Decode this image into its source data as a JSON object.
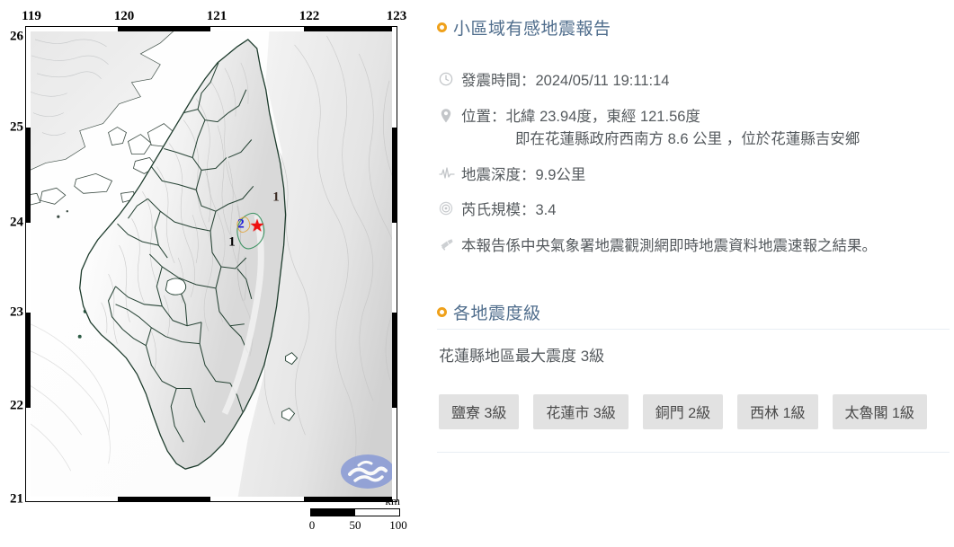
{
  "report": {
    "heading": "小區域有感地震報告",
    "details": [
      {
        "icon": "clock-icon",
        "label": "發震時間：",
        "value": "2024/05/11 19:11:14",
        "sub": ""
      },
      {
        "icon": "map-pin-icon",
        "label": "位置：",
        "value": "北緯 23.94度，東經 121.56度",
        "sub": "即在花蓮縣政府西南方 8.6 公里 ，位於花蓮縣吉安鄉"
      },
      {
        "icon": "waveform-icon",
        "label": "地震深度：",
        "value": "9.9公里",
        "sub": ""
      },
      {
        "icon": "ripple-icon",
        "label": "芮氏規模：",
        "value": "3.4",
        "sub": ""
      },
      {
        "icon": "megaphone-icon",
        "label": "",
        "value": "本報告係中央氣象署地震觀測網即時地震資料地震速報之結果。",
        "sub": ""
      }
    ]
  },
  "intensity": {
    "heading": "各地震度級",
    "max_text": "花蓮縣地區最大震度 3級",
    "stations": [
      {
        "name": "鹽寮",
        "level": "3級"
      },
      {
        "name": "花蓮市",
        "level": "3級"
      },
      {
        "name": "銅門",
        "level": "2級"
      },
      {
        "name": "西林",
        "level": "1級"
      },
      {
        "name": "太魯閣",
        "level": "1級"
      }
    ]
  },
  "map": {
    "lon_ticks": [
      "119",
      "120",
      "121",
      "122",
      "123"
    ],
    "lat_ticks": [
      "26",
      "25",
      "24",
      "23",
      "22",
      "21"
    ],
    "scale_unit": "km",
    "scale_ticks": [
      "0",
      "50",
      "100"
    ],
    "epicenter": {
      "marker": "★",
      "lon": 121.56,
      "lat": 23.94
    },
    "intensity_labels": [
      {
        "text": "2",
        "lon": 121.49,
        "lat": 23.99,
        "color": "#2020d8"
      },
      {
        "text": "1",
        "lon": 121.43,
        "lat": 23.87,
        "color": "#000000"
      },
      {
        "text": "1",
        "lon": 121.67,
        "lat": 24.13,
        "color": "#3a2a22"
      }
    ],
    "watermark": "cwa-wave-logo"
  },
  "colors": {
    "accent": "#efa11b",
    "heading": "#4f6d8c",
    "body_text": "#555a5e",
    "badge_bg": "#e2e2e2",
    "epicenter": "#ee1111",
    "divider": "#e8eef4"
  }
}
